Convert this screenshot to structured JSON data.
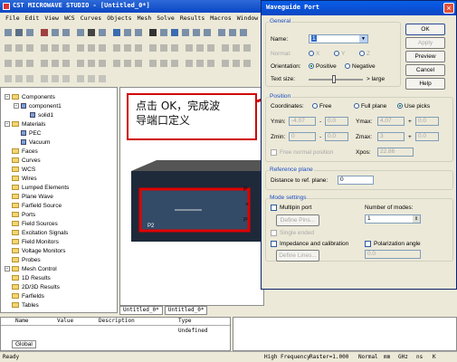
{
  "app": {
    "title": "CST MICROWAVE STUDIO - [Untitled_0*]"
  },
  "menu": [
    "File",
    "Edit",
    "View",
    "WCS",
    "Curves",
    "Objects",
    "Mesh",
    "Solve",
    "Results",
    "Macros",
    "Window",
    "Help"
  ],
  "tree": {
    "items": [
      {
        "label": "Components",
        "indent": 0,
        "folder": true,
        "plus": true
      },
      {
        "label": "component1",
        "indent": 1,
        "folder": false,
        "plus": true
      },
      {
        "label": "solid1",
        "indent": 2,
        "folder": false,
        "plus": false
      },
      {
        "label": "Materials",
        "indent": 0,
        "folder": true,
        "plus": true
      },
      {
        "label": "PEC",
        "indent": 1,
        "folder": false,
        "plus": false
      },
      {
        "label": "Vacuum",
        "indent": 1,
        "folder": false,
        "plus": false
      },
      {
        "label": "Faces",
        "indent": 0,
        "folder": true,
        "plus": false
      },
      {
        "label": "Curves",
        "indent": 0,
        "folder": true,
        "plus": false
      },
      {
        "label": "WCS",
        "indent": 0,
        "folder": true,
        "plus": false
      },
      {
        "label": "Wires",
        "indent": 0,
        "folder": true,
        "plus": false
      },
      {
        "label": "Lumped Elements",
        "indent": 0,
        "folder": true,
        "plus": false
      },
      {
        "label": "Plane Wave",
        "indent": 0,
        "folder": true,
        "plus": false
      },
      {
        "label": "Farfield Source",
        "indent": 0,
        "folder": true,
        "plus": false
      },
      {
        "label": "Ports",
        "indent": 0,
        "folder": true,
        "plus": false
      },
      {
        "label": "Field Sources",
        "indent": 0,
        "folder": true,
        "plus": false
      },
      {
        "label": "Excitation Signals",
        "indent": 0,
        "folder": true,
        "plus": false
      },
      {
        "label": "Field Monitors",
        "indent": 0,
        "folder": true,
        "plus": false
      },
      {
        "label": "Voltage Monitors",
        "indent": 0,
        "folder": true,
        "plus": false
      },
      {
        "label": "Probes",
        "indent": 0,
        "folder": true,
        "plus": false
      },
      {
        "label": "Mesh Control",
        "indent": 0,
        "folder": true,
        "plus": true
      },
      {
        "label": "1D Results",
        "indent": 0,
        "folder": true,
        "plus": false
      },
      {
        "label": "2D/3D Results",
        "indent": 0,
        "folder": true,
        "plus": false
      },
      {
        "label": "Farfields",
        "indent": 0,
        "folder": true,
        "plus": false
      },
      {
        "label": "Tables",
        "indent": 0,
        "folder": true,
        "plus": false
      }
    ]
  },
  "callout": {
    "line1": "点击 OK，完成波",
    "line2": "导端口定义"
  },
  "view_tabs": [
    "Untitled_0*",
    "Untitled_0*"
  ],
  "view_labels": {
    "p1": "P",
    "p2": "P",
    "p3": "P2",
    "x": "×"
  },
  "bottom_table": {
    "headers": [
      "Name",
      "Value",
      "Description",
      "Type"
    ],
    "type_value": "Undefined",
    "tab": "Global"
  },
  "status": {
    "left": "Ready",
    "items": [
      "High Frequency",
      "Raster=1.000",
      "Normal",
      "mm",
      "GHz",
      "ns",
      "K"
    ]
  },
  "dialog": {
    "title": "Waveguide Port",
    "buttons": {
      "ok": "OK",
      "apply": "Apply",
      "preview": "Preview",
      "cancel": "Cancel",
      "help": "Help"
    },
    "general": {
      "legend": "General",
      "name_label": "Name:",
      "name_value": "1",
      "normal_label": "Normal:",
      "normal_x": "X",
      "normal_y": "Y",
      "normal_z": "Z",
      "orientation_label": "Orientation:",
      "orientation_positive": "Positive",
      "orientation_negative": "Negative",
      "text_size_label": "Text size:",
      "text_size_large": "large"
    },
    "position": {
      "legend": "Position",
      "coords_label": "Coordinates:",
      "coords_free": "Free",
      "coords_full": "Full plane",
      "coords_picks": "Use picks",
      "ymin_label": "Ymin:",
      "ymin": "-4.07",
      "ymin_plus": "0.0",
      "ymax_label": "Ymax:",
      "ymax": "4.07",
      "ymax_plus": "0.0",
      "zmin_label": "Zmin:",
      "zmin": "0",
      "zmin_plus": "0.0",
      "zmax_label": "Zmax:",
      "zmax": "3",
      "zmax_plus": "0.0",
      "free_normal_label": "Free normal position",
      "xpos_label": "Xpos:",
      "xpos": "22.86",
      "minus": "-",
      "plus": "+"
    },
    "reference": {
      "legend": "Reference plane",
      "dist_label": "Distance to ref. plane:",
      "dist": "0"
    },
    "mode": {
      "legend": "Mode settings",
      "multipin": "Multipin port",
      "define_pins": "Define Pins...",
      "single_ended": "Single ended",
      "num_modes_label": "Number of modes:",
      "num_modes": "1",
      "impedance": "Impedance and calibration",
      "polarization": "Polarization angle",
      "define_lines": "Define Lines...",
      "polar_value": "0.0"
    }
  }
}
